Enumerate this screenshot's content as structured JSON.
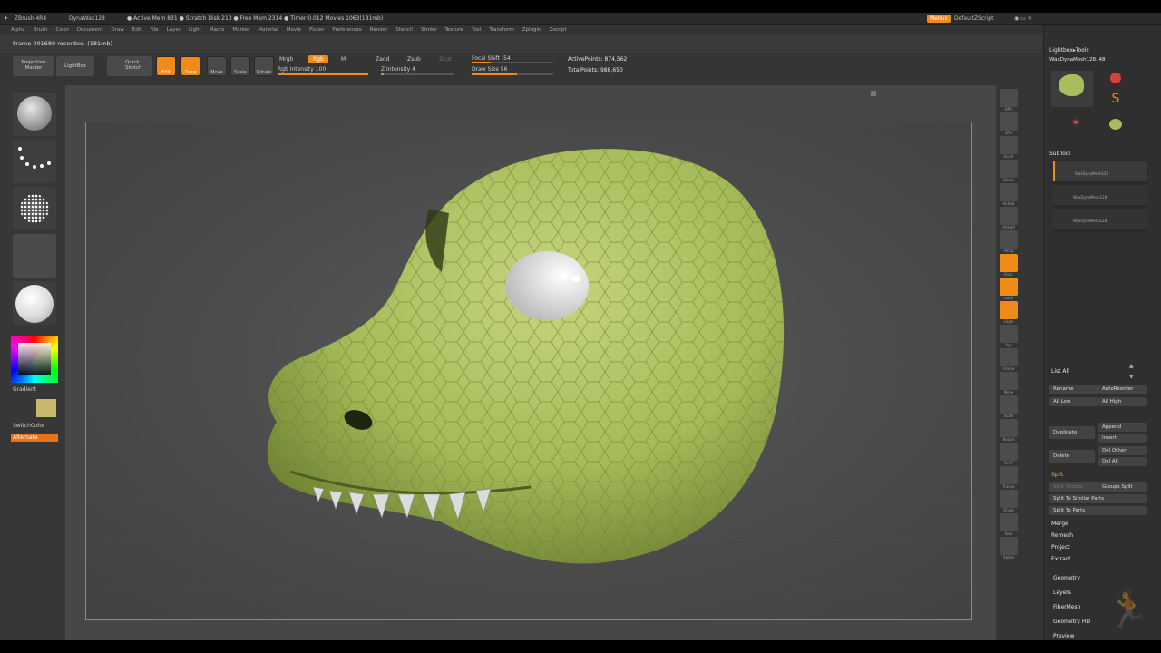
{
  "titlebar": {
    "app": "ZBrush 4R4",
    "document": "DynaWax128",
    "status": "● Active Mem 831 ● Scratch Disk 210 ● Free Mem 2314 ● Timer 0.012 Movies 1063(181mb)",
    "menus_btn": "Menus",
    "script_btn": "DefaultZScript"
  },
  "menubar": {
    "items": [
      "Alpha",
      "Brush",
      "Color",
      "Document",
      "Draw",
      "Edit",
      "File",
      "Layer",
      "Light",
      "Macro",
      "Marker",
      "Material",
      "Movie",
      "Picker",
      "Preferences",
      "Render",
      "Stencil",
      "Stroke",
      "Texture",
      "Tool",
      "Transform",
      "Zplugin",
      "Zscript"
    ]
  },
  "status": {
    "recording": "Frame 001680 recorded. (181mb)"
  },
  "toolbar": {
    "projection_master": "Projection Master",
    "lightbox": "LightBox",
    "quick_sketch": "Quick Sketch",
    "edit": "Edit",
    "draw": "Draw",
    "move": "Move",
    "scale": "Scale",
    "rotate": "Rotate",
    "mrgb": "Mrgb",
    "rgb": "Rgb",
    "m": "M",
    "zadd": "Zadd",
    "zsub": "Zsub",
    "zcut": "Zcut",
    "rgb_intensity": "Rgb Intensity 100",
    "z_intensity": "Z Intensity 4",
    "focal_shift": "Focal Shift -54",
    "draw_size": "Draw Size 56",
    "active_points": "ActivePoints: 874,562",
    "total_points": "TotalPoints: 988,650",
    "rgb_intensity_fill": 1.0,
    "z_intensity_fill": 0.04,
    "focal_shift_fill": 0.23,
    "draw_size_fill": 0.56
  },
  "left_shelf": {
    "gradient": "Gradient",
    "switch_color": "SwitchColor",
    "alternate": "Alternate"
  },
  "right_shelf": {
    "items": [
      "BPR",
      "SPix",
      "Scroll",
      "Zoom",
      "Actual",
      "AAHalf",
      "Persp",
      "Floor",
      "Local",
      "LSym",
      "Xyz",
      "Frame",
      "Move",
      "Scale",
      "Rotate",
      "PolyF",
      "Transp",
      "Ghost",
      "Solo",
      "Xpose"
    ]
  },
  "right_panel": {
    "header": "Lightbox▸Tools",
    "current_tool": "WaxDynaMesh128. 48",
    "tool_thumbs": [
      "WaxDynaMesh128",
      "Sphere3D",
      "SimpleBrush",
      "PolyMesh3D",
      "WaxDynaMesh128"
    ],
    "subtool_title": "SubTool",
    "subtools": [
      "WaxDynaMesh128",
      "WaxDynaMesh128",
      "WaxDynaMesh128"
    ],
    "list_all": "List All",
    "rename": "Rename",
    "autoreorder": "AutoReorder",
    "all_low": "All Low",
    "all_high": "All High",
    "duplicate": "Duplicate",
    "append": "Append",
    "insert": "Insert",
    "delete": "Delete",
    "del_other": "Del Other",
    "del_all": "Del All",
    "split": "Split",
    "split_hidden": "Split Hidden",
    "groups_split": "Groups Split",
    "split_similar": "Split To Similar Parts",
    "split_parts": "Split To Parts",
    "merge": "Merge",
    "remesh": "Remesh",
    "project": "Project",
    "extract": "Extract",
    "sections": [
      "Geometry",
      "Layers",
      "FiberMesh",
      "Geometry HD",
      "Preview"
    ]
  },
  "colors": {
    "accent": "#f08a18",
    "skin": "#a8bd5e",
    "background": "#3a3a3a"
  }
}
